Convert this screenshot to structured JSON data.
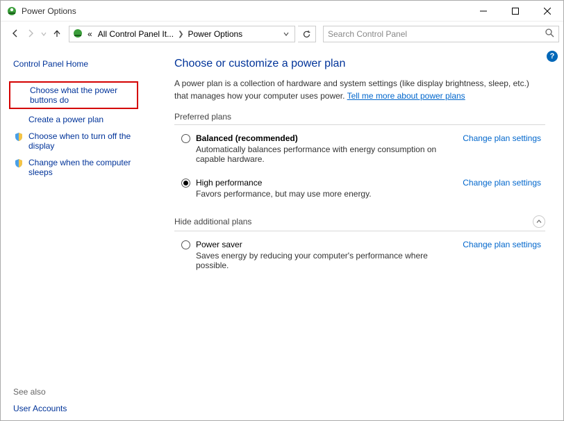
{
  "window": {
    "title": "Power Options"
  },
  "breadcrumb": {
    "prefix": "«",
    "seg1": "All Control Panel It...",
    "seg2": "Power Options"
  },
  "search": {
    "placeholder": "Search Control Panel"
  },
  "sidebar": {
    "home": "Control Panel Home",
    "items": [
      {
        "label": "Choose what the power buttons do"
      },
      {
        "label": "Create a power plan"
      },
      {
        "label": "Choose when to turn off the display"
      },
      {
        "label": "Change when the computer sleeps"
      }
    ],
    "see_also_hdr": "See also",
    "see_also_link": "User Accounts"
  },
  "main": {
    "heading": "Choose or customize a power plan",
    "desc_pre": "A power plan is a collection of hardware and system settings (like display brightness, sleep, etc.) that manages how your computer uses power. ",
    "desc_link": "Tell me more about power plans",
    "preferred_hdr": "Preferred plans",
    "additional_hdr": "Hide additional plans",
    "change_label": "Change plan settings",
    "plans_preferred": [
      {
        "name": "Balanced (recommended)",
        "desc": "Automatically balances performance with energy consumption on capable hardware.",
        "selected": false,
        "bold": true
      },
      {
        "name": "High performance",
        "desc": "Favors performance, but may use more energy.",
        "selected": true,
        "bold": false
      }
    ],
    "plans_additional": [
      {
        "name": "Power saver",
        "desc": "Saves energy by reducing your computer's performance where possible.",
        "selected": false,
        "bold": false
      }
    ]
  }
}
